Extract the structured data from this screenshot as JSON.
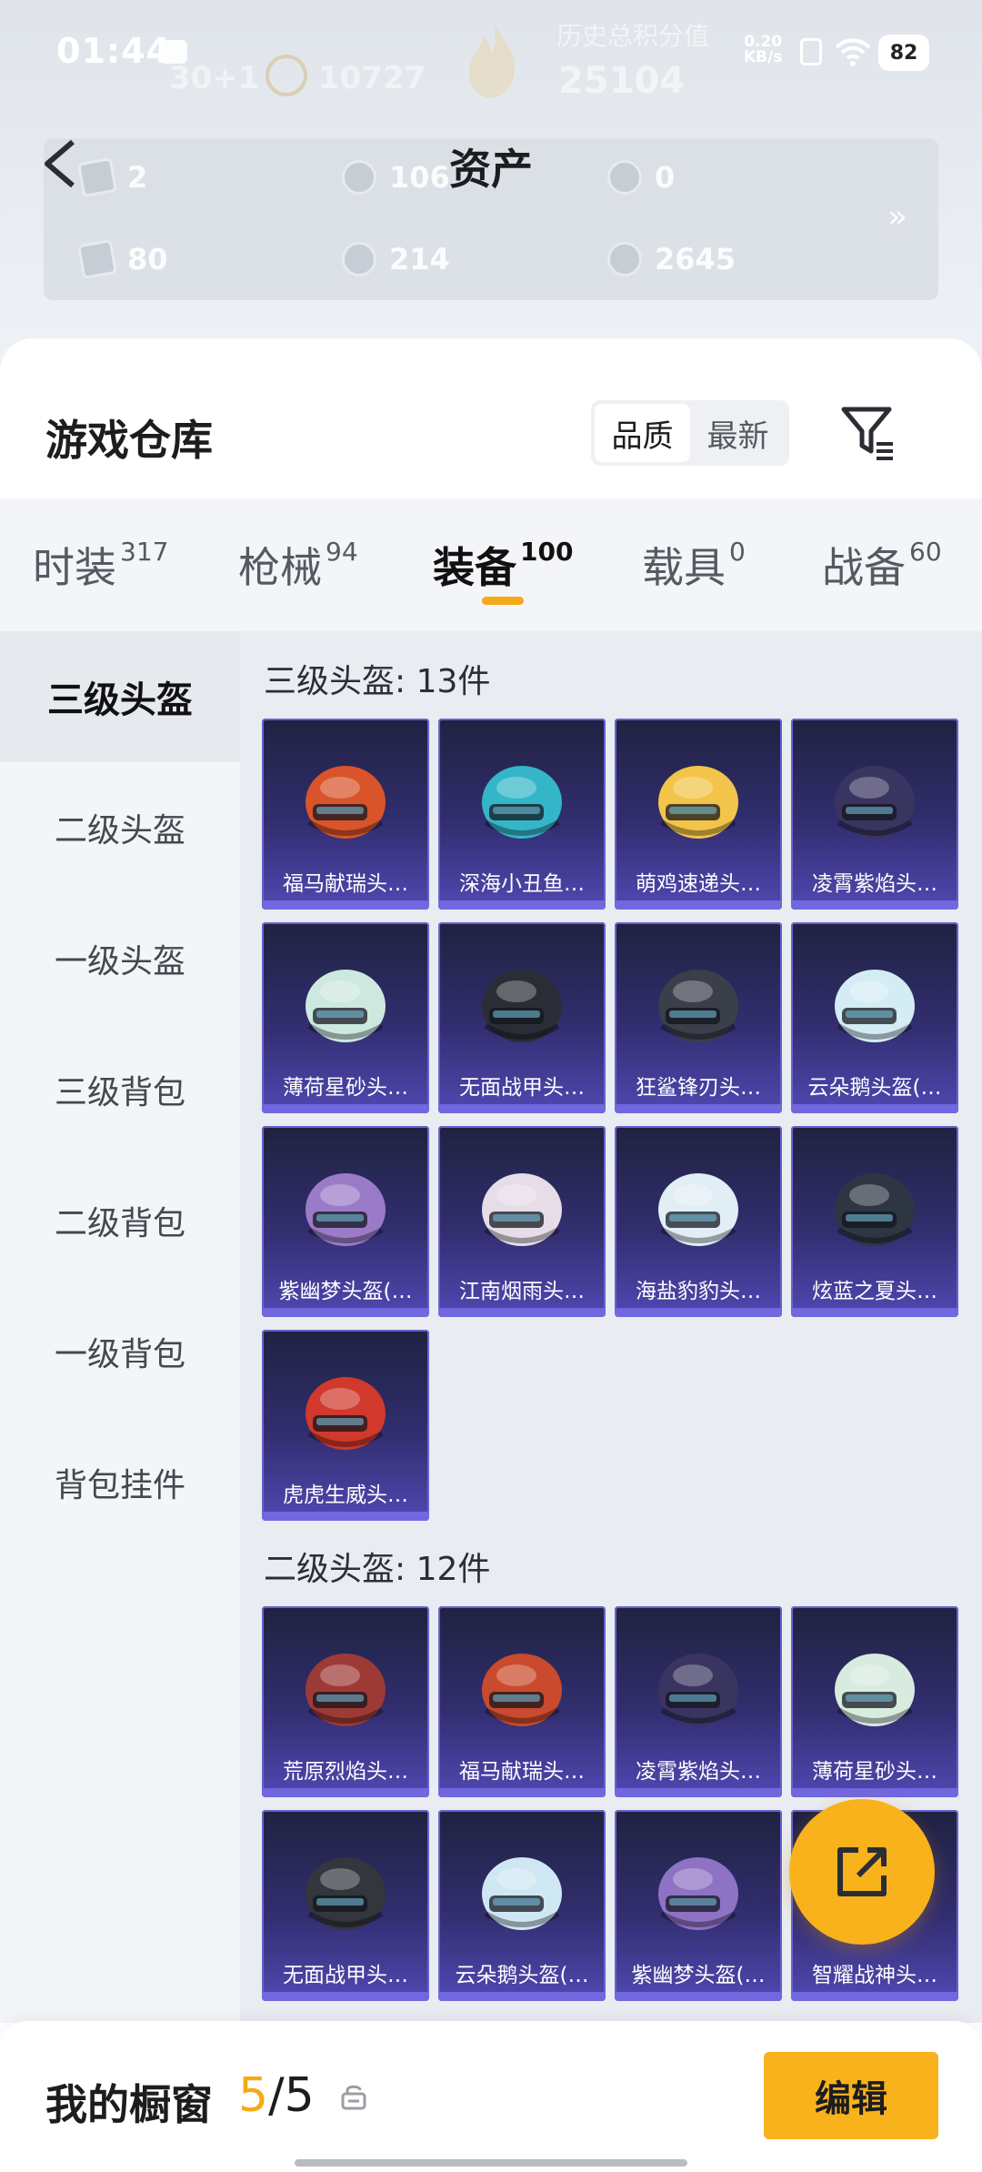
{
  "status_bar": {
    "time": "01:44",
    "net_speed_value": "0.20",
    "net_speed_unit": "KB/s",
    "battery": "82"
  },
  "faded_header": {
    "label": "历史总积分值",
    "score": "25104",
    "rank": "10727",
    "left_value": "30+1"
  },
  "header": {
    "title": "资产"
  },
  "assets": [
    {
      "icon": "card-icon",
      "value": "2"
    },
    {
      "icon": "s-coin-icon",
      "value": "106"
    },
    {
      "icon": "a-coin-icon",
      "value": "0"
    },
    {
      "icon": "ticket-icon",
      "value": "80"
    },
    {
      "icon": "silver-coin-icon",
      "value": "214"
    },
    {
      "icon": "gold-coin-icon",
      "value": "2645"
    }
  ],
  "assets_more": "»",
  "warehouse": {
    "title": "游戏仓库",
    "sort": {
      "quality": "品质",
      "newest": "最新",
      "selected": "品质"
    }
  },
  "tabs": [
    {
      "label": "时装",
      "count": "317"
    },
    {
      "label": "枪械",
      "count": "94"
    },
    {
      "label": "装备",
      "count": "100",
      "active": true
    },
    {
      "label": "载具",
      "count": "0"
    },
    {
      "label": "战备",
      "count": "60"
    }
  ],
  "sidebar": [
    {
      "label": "三级头盔",
      "active": true
    },
    {
      "label": "二级头盔"
    },
    {
      "label": "一级头盔"
    },
    {
      "label": "三级背包"
    },
    {
      "label": "二级背包"
    },
    {
      "label": "一级背包"
    },
    {
      "label": "背包挂件"
    }
  ],
  "sections": [
    {
      "title": "三级头盔: 13件",
      "items": [
        {
          "name": "福马献瑞头…",
          "color": "#d9542a"
        },
        {
          "name": "深海小丑鱼…",
          "color": "#35b6c8"
        },
        {
          "name": "萌鸡速递头…",
          "color": "#f2c54a"
        },
        {
          "name": "凌霄紫焰头…",
          "color": "#3a3560"
        },
        {
          "name": "薄荷星砂头…",
          "color": "#cde9df"
        },
        {
          "name": "无面战甲头…",
          "color": "#2a2d35"
        },
        {
          "name": "狂鲨锋刃头…",
          "color": "#3b3f4a"
        },
        {
          "name": "云朵鹅头盔(…",
          "color": "#d4ecf4"
        },
        {
          "name": "紫幽梦头盔(…",
          "color": "#9b7bc8"
        },
        {
          "name": "江南烟雨头…",
          "color": "#e6dde8"
        },
        {
          "name": "海盐豹豹头…",
          "color": "#e2eef6"
        },
        {
          "name": "炫蓝之夏头…",
          "color": "#2e3644"
        },
        {
          "name": "虎虎生威头…",
          "color": "#d0392c"
        }
      ]
    },
    {
      "title": "二级头盔: 12件",
      "items": [
        {
          "name": "荒原烈焰头…",
          "color": "#9e3a36"
        },
        {
          "name": "福马献瑞头…",
          "color": "#c94a2c"
        },
        {
          "name": "凌霄紫焰头…",
          "color": "#3a3560"
        },
        {
          "name": "薄荷星砂头…",
          "color": "#d7ebdf"
        },
        {
          "name": "无面战甲头…",
          "color": "#33363d"
        },
        {
          "name": "云朵鹅头盔(…",
          "color": "#cfe7f2"
        },
        {
          "name": "紫幽梦头盔(…",
          "color": "#8e72c4"
        },
        {
          "name": "智耀战神头…",
          "color": "#5b5a7c"
        }
      ]
    }
  ],
  "bottom_bar": {
    "label": "我的橱窗",
    "current": "5",
    "separator": "/",
    "total": "5",
    "edit": "编辑"
  },
  "colors": {
    "accent": "#f8b21c",
    "card_purple": "#5148b2"
  }
}
